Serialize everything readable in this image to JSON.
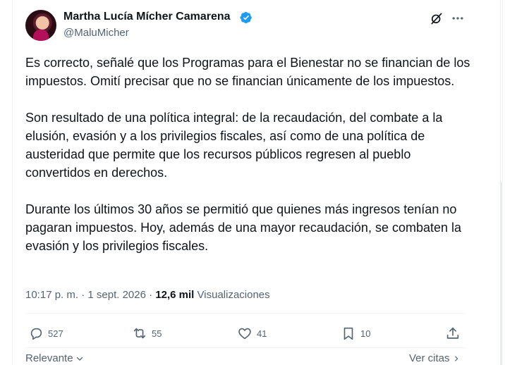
{
  "author": {
    "name": "Martha Lucía Mícher Camarena",
    "handle": "@MaluMicher",
    "verified_color": "#1d9bf0"
  },
  "tweet": {
    "paragraphs": [
      "Es correcto, señalé que los Programas para el Bienestar no se financian de los impuestos. Omití precisar que no se financian únicamente de los impuestos.",
      "Son resultado de una política integral: de la recaudación, del combate a la elusión, evasión y a los privilegios fiscales, así como de una política de austeridad que permite que los recursos públicos regresen al pueblo convertidos en derechos.",
      "Durante los últimos 30 años se permitió que quienes más ingresos tenían no pagaran impuestos. Hoy, además de una mayor recaudación, se combaten la evasión y los privilegios fiscales."
    ],
    "time": "10:17 p. m.",
    "separator": "·",
    "date": "1 sept. 2026",
    "views_count": "12,6 mil",
    "views_label": "Visualizaciones"
  },
  "actions": {
    "replies": "527",
    "reposts": "55",
    "likes": "41",
    "bookmarks": "10"
  },
  "footer": {
    "sort_label": "Relevante",
    "quotes_label": "Ver citas"
  },
  "icons": [
    "grok-icon",
    "more-icon",
    "reply-icon",
    "repost-icon",
    "like-icon",
    "bookmark-icon",
    "share-icon",
    "chevron-down-icon",
    "chevron-right-icon",
    "verified-badge-icon"
  ]
}
